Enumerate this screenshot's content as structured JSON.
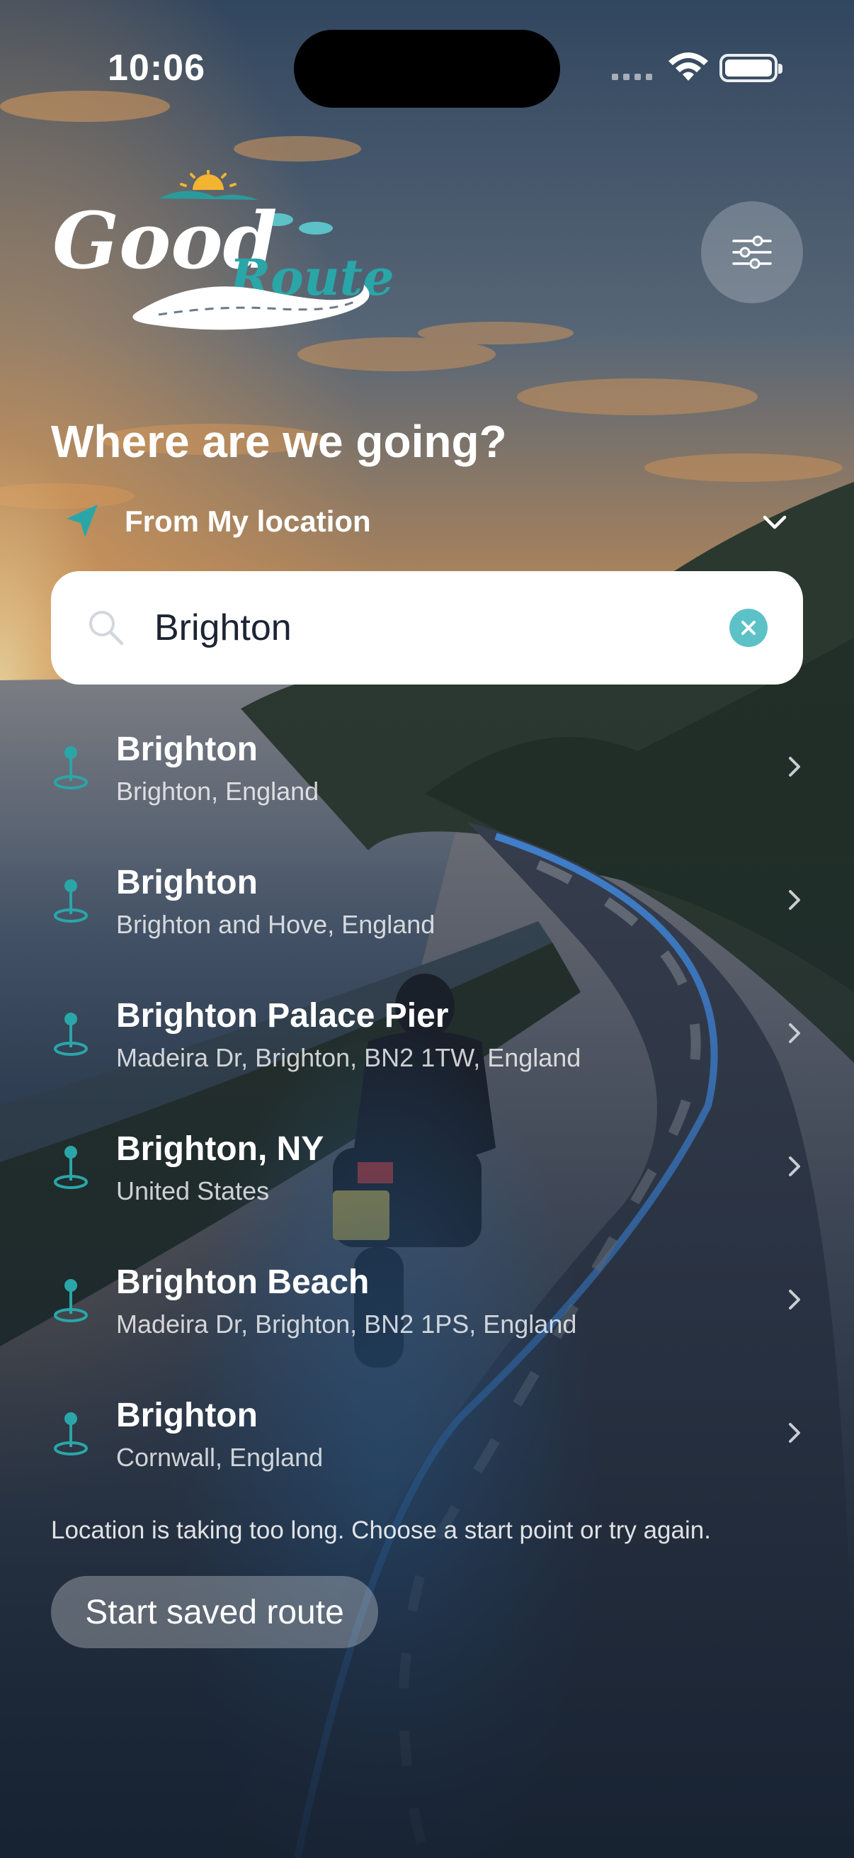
{
  "status_bar": {
    "time": "10:06"
  },
  "brand": {
    "name_part1": "Good",
    "name_part2": "Route"
  },
  "colors": {
    "accent": "#5cc2c7",
    "pin": "#2aa6a8",
    "sky_top": "#2f4a6a",
    "sunset": "#e9a55a"
  },
  "header": {
    "title": "Where are we going?"
  },
  "origin": {
    "label": "From My location",
    "icon": "navigation-arrow-icon"
  },
  "search": {
    "value": "Brighton",
    "placeholder": ""
  },
  "results": [
    {
      "title": "Brighton",
      "subtitle": "Brighton, England"
    },
    {
      "title": "Brighton",
      "subtitle": "Brighton and Hove, England"
    },
    {
      "title": "Brighton Palace Pier",
      "subtitle": "Madeira Dr, Brighton, BN2 1TW, England"
    },
    {
      "title": "Brighton, NY",
      "subtitle": "United States"
    },
    {
      "title": "Brighton Beach",
      "subtitle": "Madeira Dr, Brighton, BN2 1PS, England"
    },
    {
      "title": "Brighton",
      "subtitle": "Cornwall, England"
    }
  ],
  "notice": "Location is taking too long. Choose a start point or try again.",
  "saved_route_button": "Start saved route"
}
